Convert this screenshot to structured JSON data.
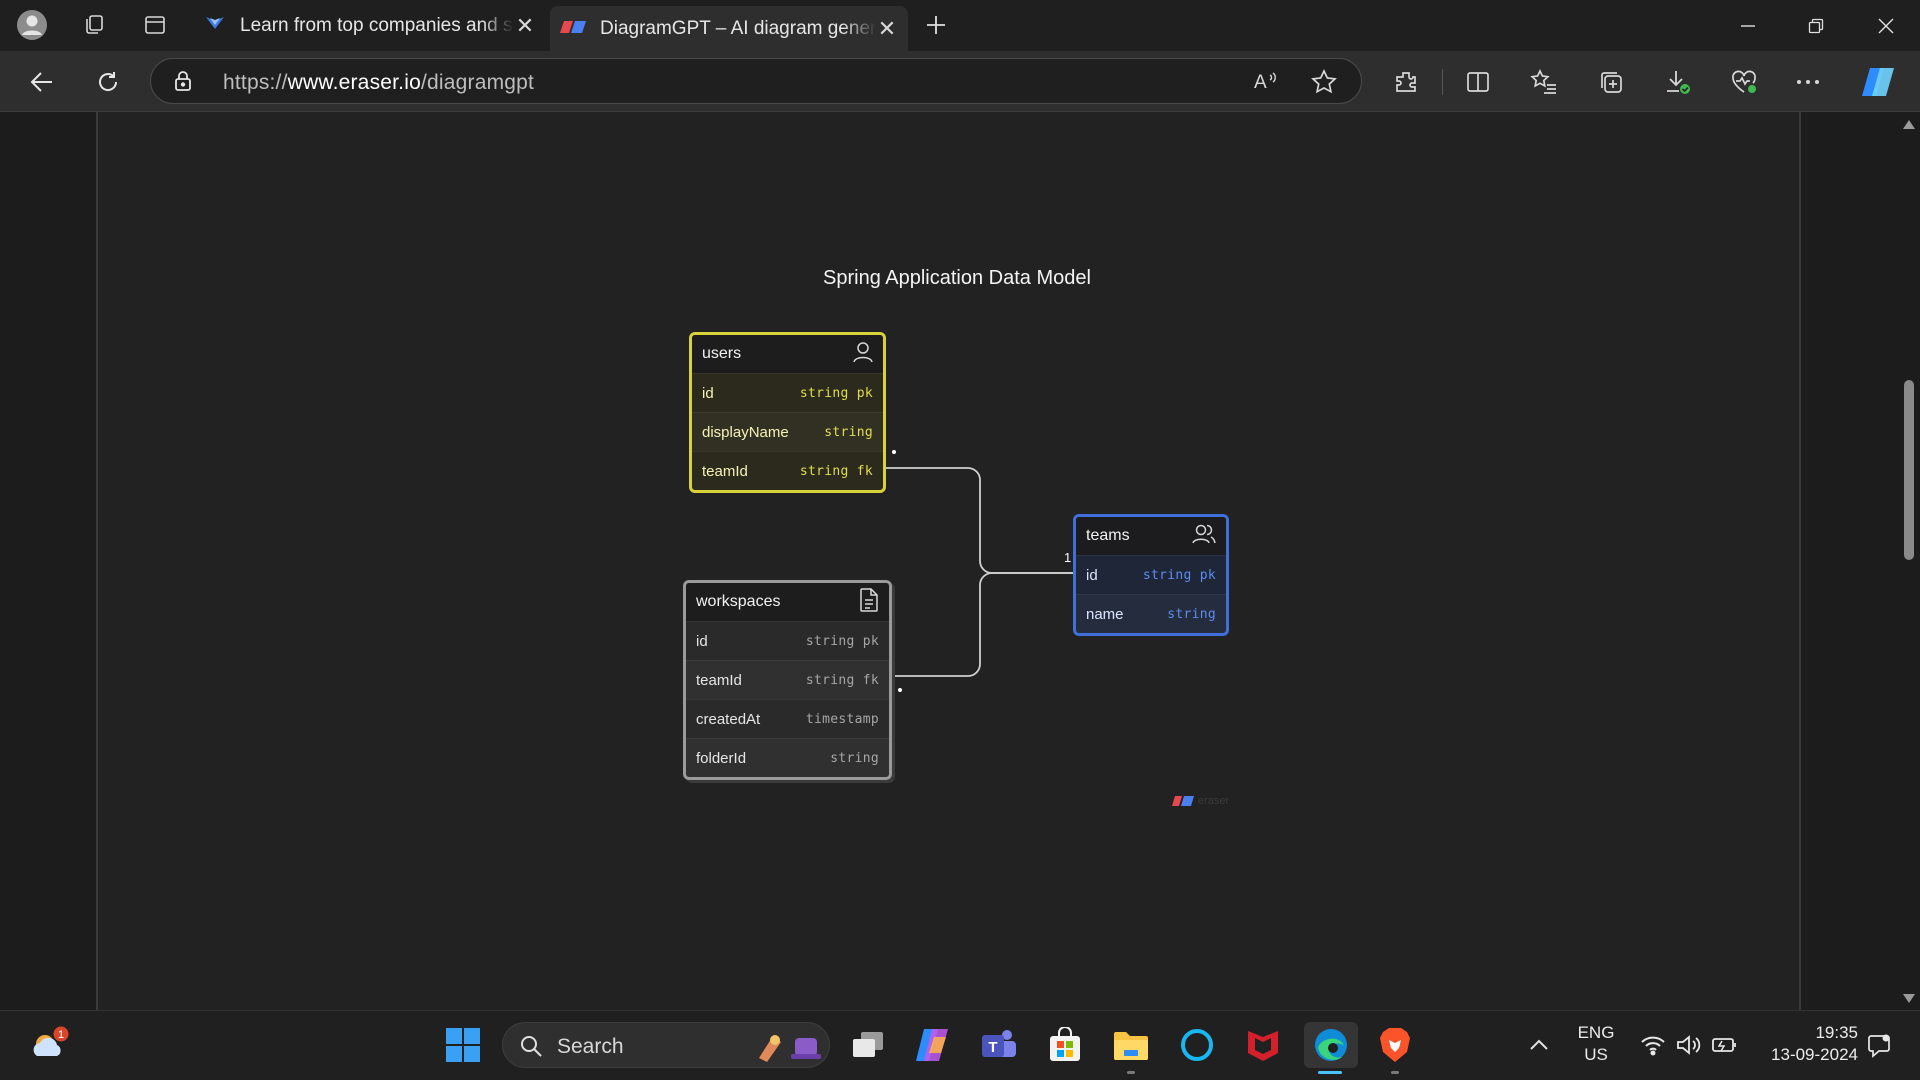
{
  "browser": {
    "tabs": [
      {
        "title": "Learn from top companies and se",
        "active": false
      },
      {
        "title": "DiagramGPT – AI diagram genera",
        "active": true
      }
    ],
    "url_prefix": "https://",
    "url_domain": "www.eraser.io",
    "url_path": "/diagramgpt"
  },
  "diagram": {
    "title": "Spring Application Data Model",
    "entities": {
      "users": {
        "name": "users",
        "icon": "person-icon",
        "color": "#d7d23a",
        "fields": [
          {
            "name": "id",
            "type": "string",
            "key": "pk"
          },
          {
            "name": "displayName",
            "type": "string",
            "key": ""
          },
          {
            "name": "teamId",
            "type": "string",
            "key": "fk"
          }
        ]
      },
      "teams": {
        "name": "teams",
        "icon": "people-icon",
        "color": "#3f6fd8",
        "fields": [
          {
            "name": "id",
            "type": "string",
            "key": "pk"
          },
          {
            "name": "name",
            "type": "string",
            "key": ""
          }
        ]
      },
      "workspaces": {
        "name": "workspaces",
        "icon": "document-icon",
        "color": "#9a9a9a",
        "fields": [
          {
            "name": "id",
            "type": "string",
            "key": "pk"
          },
          {
            "name": "teamId",
            "type": "string",
            "key": "fk"
          },
          {
            "name": "createdAt",
            "type": "timestamp",
            "key": ""
          },
          {
            "name": "folderId",
            "type": "string",
            "key": ""
          }
        ]
      }
    },
    "cardinality_label": "1 1",
    "watermark": "eraser"
  },
  "taskbar": {
    "search_label": "Search",
    "weather_badge": "1",
    "lang_top": "ENG",
    "lang_bottom": "US",
    "time": "19:35",
    "date": "13-09-2024"
  }
}
